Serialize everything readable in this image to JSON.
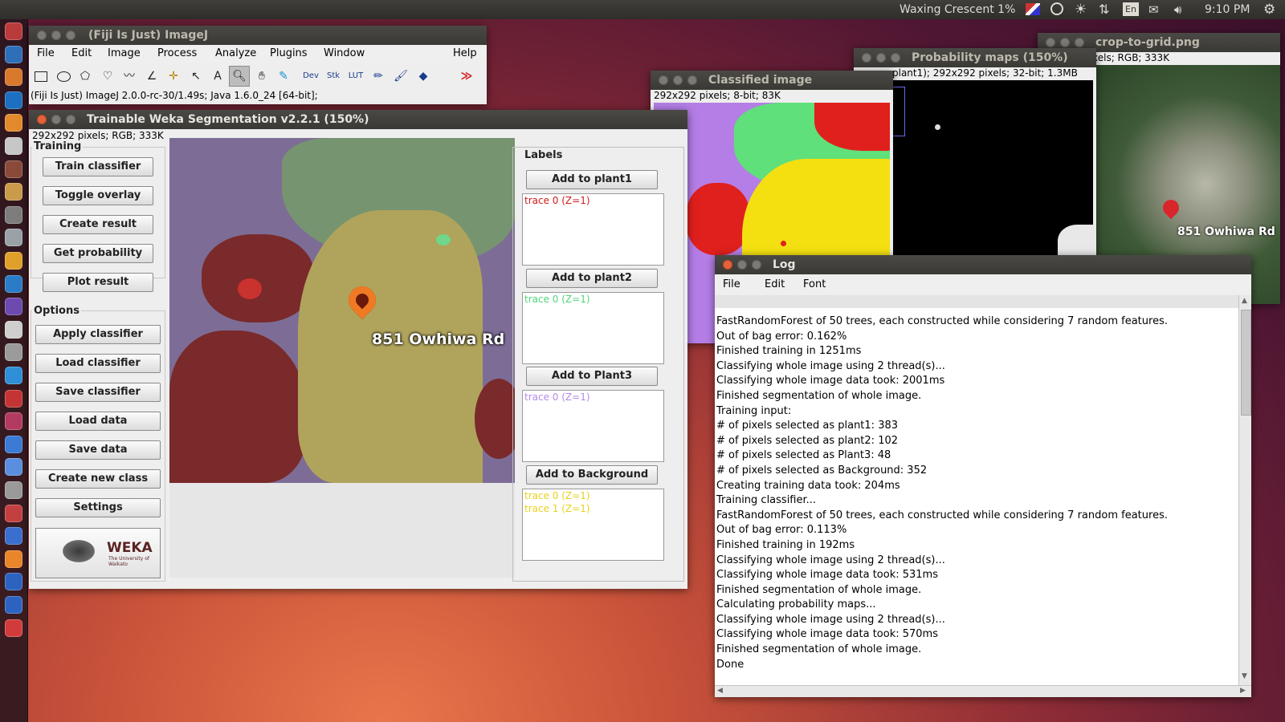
{
  "topbar": {
    "moon": "Waxing Crescent 1%",
    "lang": "En",
    "clock": "9:10 PM"
  },
  "launcher": {
    "colors": [
      "#b93b3b",
      "#2f6fb8",
      "#d9792b",
      "#1c6fc1",
      "#e38a2c",
      "#c7c7c7",
      "#8a4a3a",
      "#c99b4a",
      "#7d7d7d",
      "#9aa2a8",
      "#e0a12b",
      "#2a7cc7",
      "#6c4ab0",
      "#cfcfcf",
      "#9b9b9b",
      "#2f8fd8",
      "#c43434",
      "#b33b62",
      "#3b7bd6",
      "#5a8fe0",
      "#9a9a9a",
      "#c44040",
      "#3a6fcf",
      "#e9862a",
      "#2d63c0",
      "#2d63c0",
      "#d23b3b"
    ]
  },
  "imagej": {
    "title": "(Fiji Is Just) ImageJ",
    "menu": [
      "File",
      "Edit",
      "Image",
      "Process",
      "Analyze",
      "Plugins",
      "Window",
      "Help"
    ],
    "status": "(Fiji Is Just) ImageJ 2.0.0-rc-30/1.49s; Java 1.6.0_24 [64-bit];",
    "tools": {
      "text": "A",
      "dev": "Dev",
      "stk": "Stk",
      "lut": "LUT",
      "more": "≫"
    }
  },
  "weka": {
    "title": "Trainable Weka Segmentation v2.2.1 (150%)",
    "info": "292x292 pixels; RGB; 333K",
    "training_label": "Training",
    "training_buttons": [
      "Train classifier",
      "Toggle overlay",
      "Create result",
      "Get probability",
      "Plot result"
    ],
    "options_label": "Options",
    "options_buttons": [
      "Apply classifier",
      "Load classifier",
      "Save classifier",
      "Load data",
      "Save data",
      "Create new class",
      "Settings"
    ],
    "labels_title": "Labels",
    "map_text": "851 Owhiwa Rd",
    "logo": {
      "name": "WEKA",
      "sub": "The University of Waikato"
    },
    "classes": [
      {
        "button": "Add to plant1",
        "color": "#d21a1a",
        "traces": [
          "trace 0 (Z=1)"
        ]
      },
      {
        "button": "Add to plant2",
        "color": "#4fd67a",
        "traces": [
          "trace 0 (Z=1)"
        ]
      },
      {
        "button": "Add to Plant3",
        "color": "#b58ae8",
        "traces": [
          "trace 0 (Z=1)"
        ]
      },
      {
        "button": "Add to Background",
        "color": "#e8d21c",
        "traces": [
          "trace 0 (Z=1)",
          "trace 1 (Z=1)"
        ]
      }
    ]
  },
  "classified": {
    "title": "Classified image",
    "info": "292x292 pixels; 8-bit; 83K"
  },
  "probability": {
    "title": "Probability maps (150%)",
    "info": "plant1); 292x292 pixels; 32-bit; 1.3MB"
  },
  "crop": {
    "title": "crop-to-grid.png",
    "info": "xels; RGB; 333K",
    "map_text": "851 Owhiwa Rd"
  },
  "log": {
    "title": "Log",
    "menu": [
      "File",
      "Edit",
      "Font"
    ],
    "lines": [
      "FastRandomForest of 50 trees, each constructed while considering 7 random features.",
      "Out of bag error: 0.162%",
      "Finished training in 1251ms",
      "Classifying whole image using 2 thread(s)...",
      "Classifying whole image data took: 2001ms",
      "Finished segmentation of whole image.",
      "Training input:",
      "# of pixels selected as plant1: 383",
      "# of pixels selected as plant2: 102",
      "# of pixels selected as Plant3: 48",
      "# of pixels selected as Background: 352",
      "Creating training data took: 204ms",
      "Training classifier...",
      "FastRandomForest of 50 trees, each constructed while considering 7 random features.",
      "Out of bag error: 0.113%",
      "Finished training in 192ms",
      "Classifying whole image using 2 thread(s)...",
      "Classifying whole image data took: 531ms",
      "Finished segmentation of whole image.",
      "Calculating probability maps...",
      "Classifying whole image using 2 thread(s)...",
      "Classifying whole image data took: 570ms",
      "Finished segmentation of whole image.",
      "Done"
    ]
  }
}
